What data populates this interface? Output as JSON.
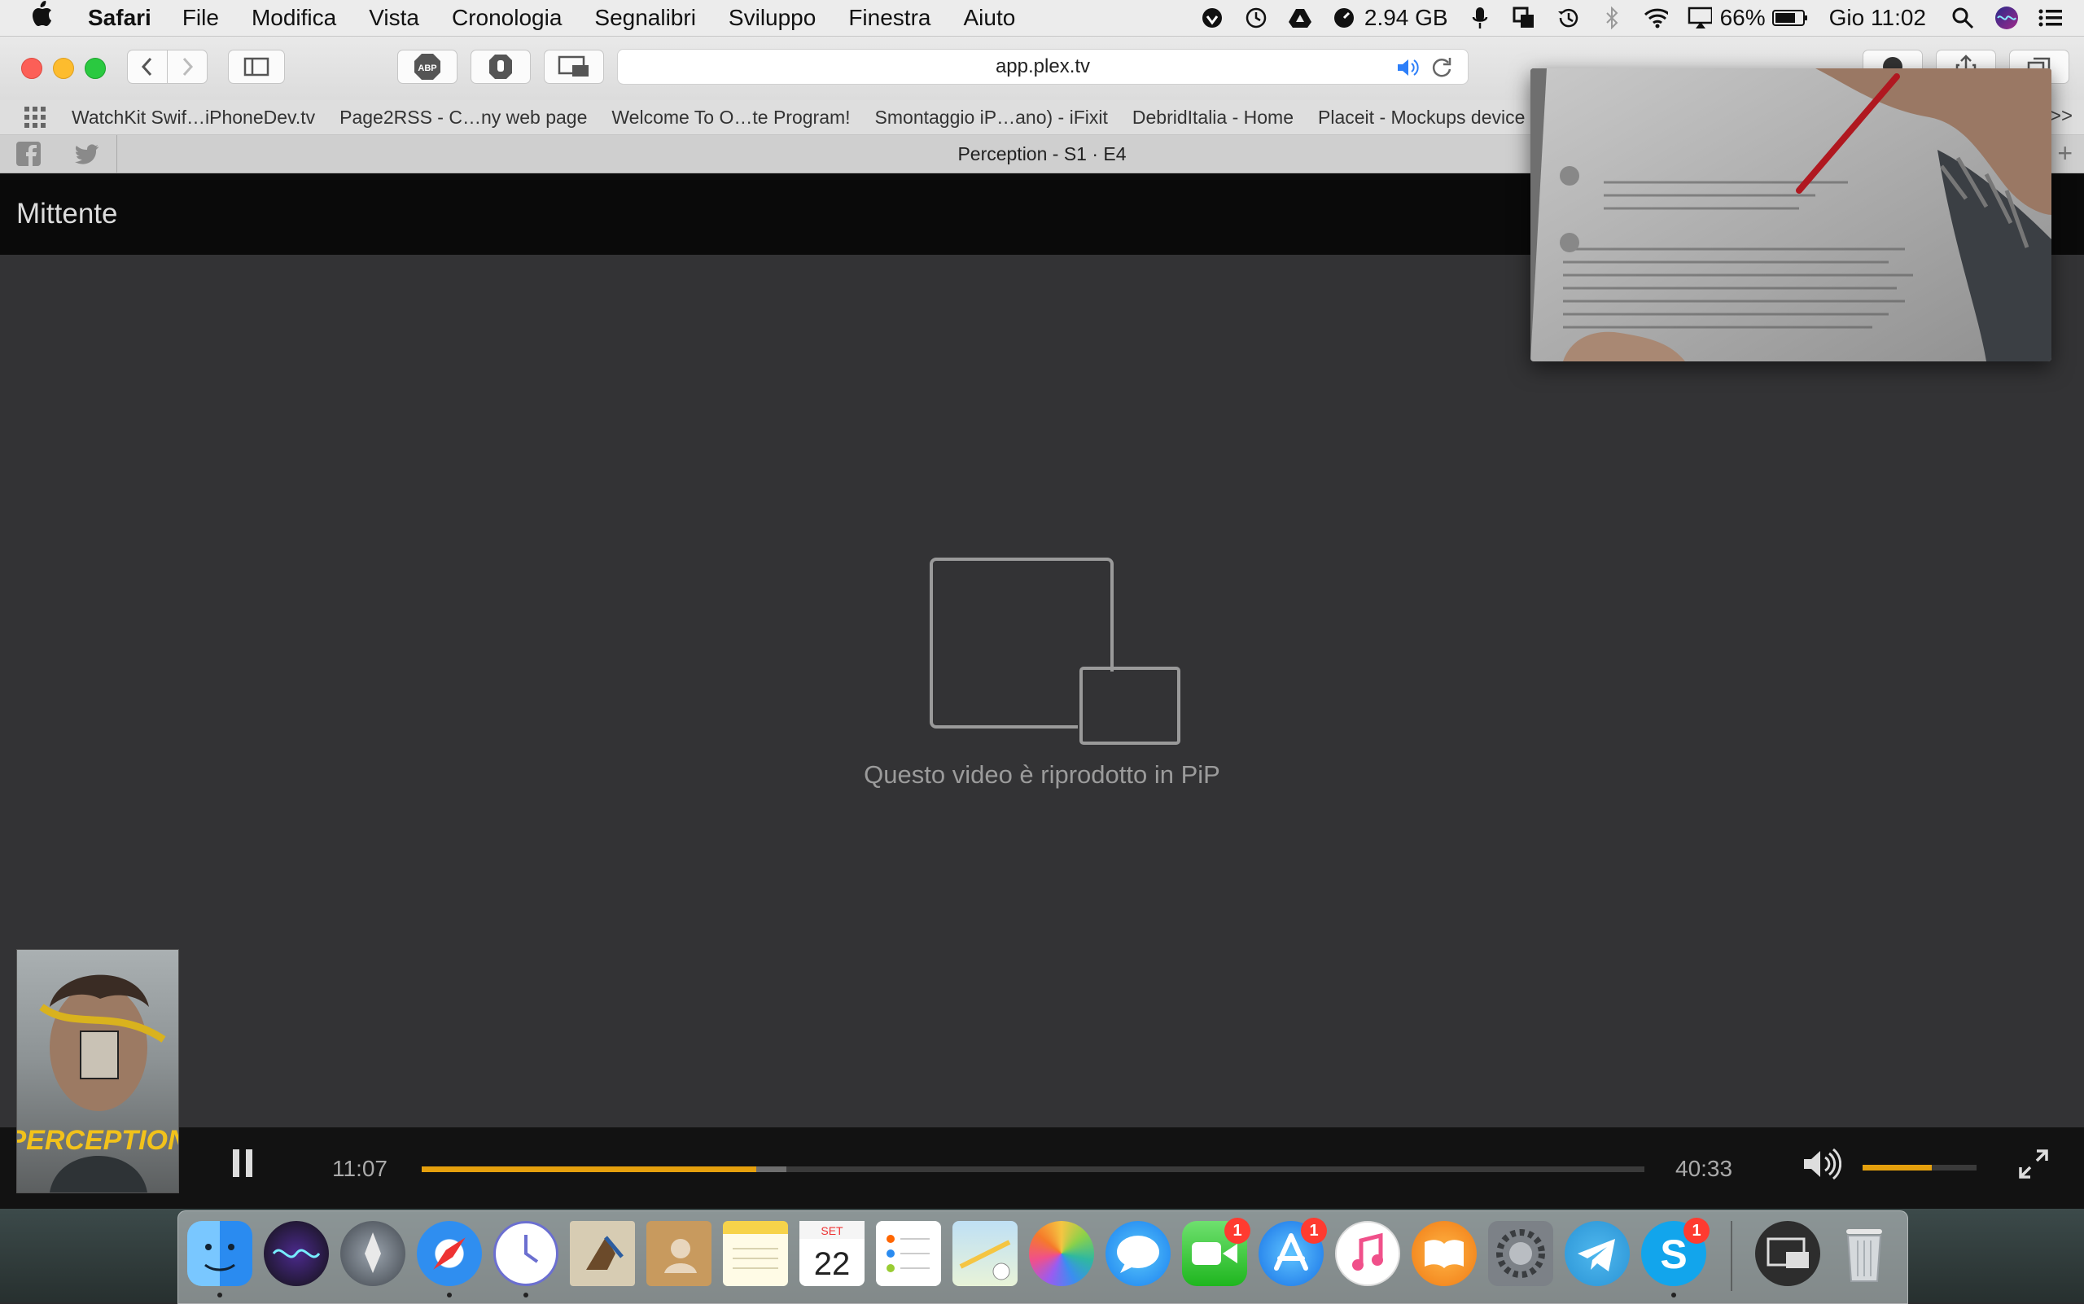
{
  "menubar": {
    "app_name": "Safari",
    "items": [
      "File",
      "Modifica",
      "Vista",
      "Cronologia",
      "Segnalibri",
      "Sviluppo",
      "Finestra",
      "Aiuto"
    ],
    "memory": "2.94 GB",
    "battery": "66%",
    "clock": "Gio 11:02"
  },
  "toolbar": {
    "url": "app.plex.tv",
    "adblock_label": "ABP"
  },
  "bookmarks": [
    "WatchKit Swif…iPhoneDev.tv",
    "Page2RSS - C…ny web page",
    "Welcome To O…te Program!",
    "Smontaggio iP…ano) - iFixit",
    "DebridItalia - Home",
    "Placeit - Mockups device"
  ],
  "bookmarks_more": ">>",
  "tab": {
    "title": "Perception - S1 · E4"
  },
  "plex": {
    "header_title": "Mittente",
    "pip_message": "Questo video è riprodotto in PiP"
  },
  "player": {
    "current_time": "11:07",
    "duration": "40:33",
    "progress": 0.2738,
    "buffered": 0.2985,
    "volume": 0.61
  },
  "dock": {
    "calendar_month": "SET",
    "calendar_day": "22",
    "badges": {
      "facetime": "1",
      "appstore": "1",
      "skype": "1"
    }
  },
  "colors": {
    "accent": "#e5a00d",
    "header": "#0a0a0a",
    "stage": "#333335"
  }
}
